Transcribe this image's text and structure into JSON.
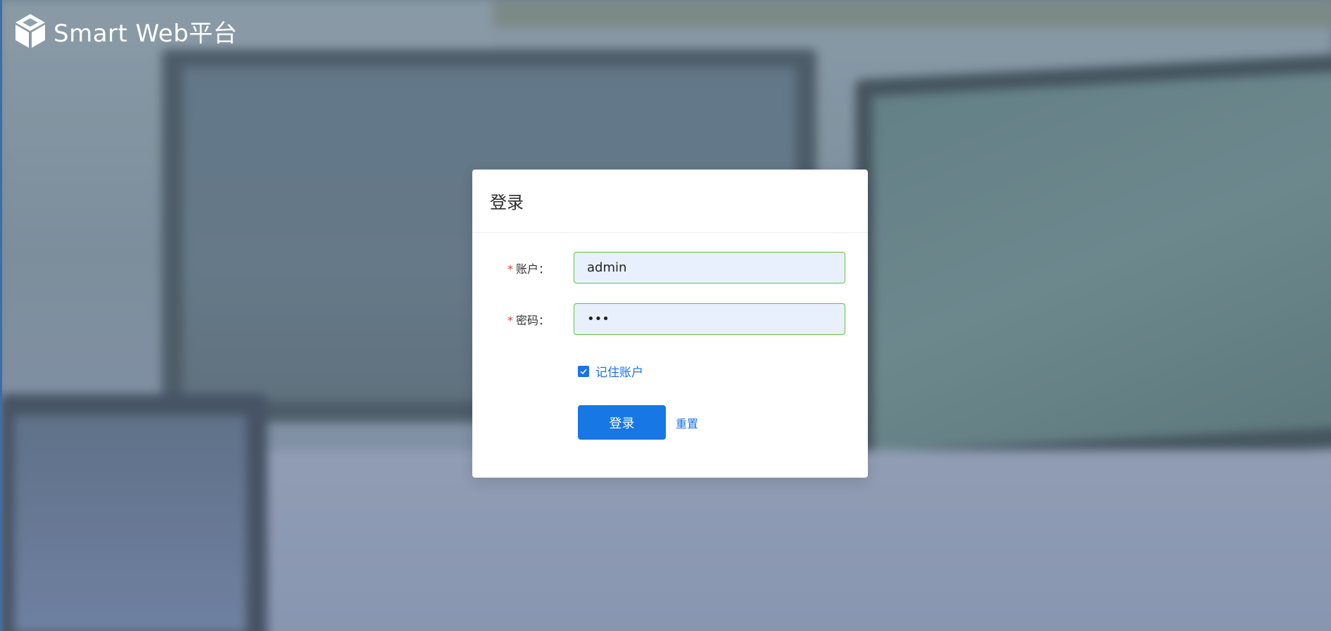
{
  "brand": {
    "name": "Smart Web平台",
    "logo_icon": "cube-logo-icon"
  },
  "login": {
    "title": "登录",
    "account_label": "账户：",
    "account_value": "admin",
    "password_label": "密码：",
    "password_value": "abc",
    "required_mark": "*",
    "remember_label": "记住账户",
    "remember_checked": true,
    "login_button": "登录",
    "reset_button": "重置"
  },
  "colors": {
    "primary": "#1677e5",
    "required": "#e53935",
    "input_border_valid": "#67c23a",
    "input_bg": "#e8f0fe"
  }
}
